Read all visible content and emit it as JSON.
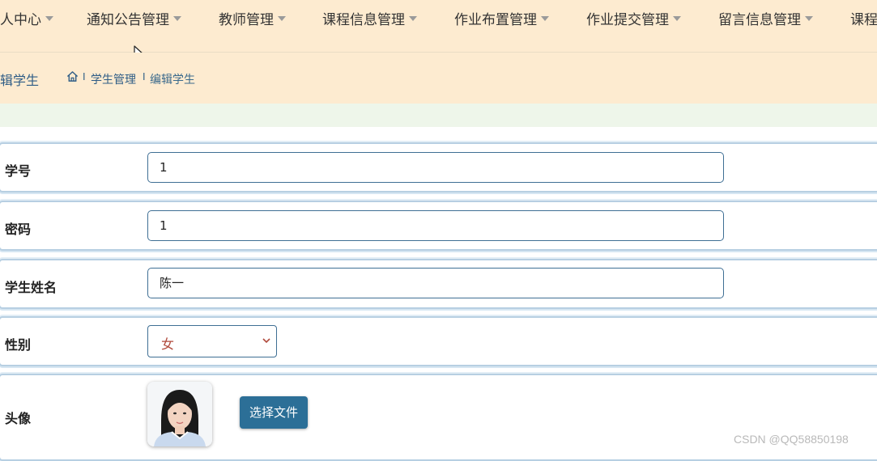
{
  "nav": {
    "items": [
      {
        "label": "人中心"
      },
      {
        "label": "通知公告管理"
      },
      {
        "label": "教师管理"
      },
      {
        "label": "课程信息管理"
      },
      {
        "label": "作业布置管理"
      },
      {
        "label": "作业提交管理"
      },
      {
        "label": "留言信息管理"
      },
      {
        "label": "课程"
      }
    ]
  },
  "subheader": {
    "title": "辑学生",
    "breadcrumb": [
      {
        "label": "学生管理"
      },
      {
        "label": "编辑学生"
      }
    ],
    "separator": "I"
  },
  "form": {
    "student_id": {
      "label": "学号",
      "value": "1"
    },
    "password": {
      "label": "密码",
      "value": "1"
    },
    "name": {
      "label": "学生姓名",
      "value": "陈一"
    },
    "gender": {
      "label": "性别",
      "selected": "女"
    },
    "avatar": {
      "label": "头像",
      "button_label": "选择文件"
    }
  },
  "watermark": "CSDN @QQ58850198",
  "colors": {
    "header_bg": "#fdebd0",
    "accent": "#2c6f97",
    "band": "#eef6ea",
    "row_border": "#b7cfe2"
  }
}
